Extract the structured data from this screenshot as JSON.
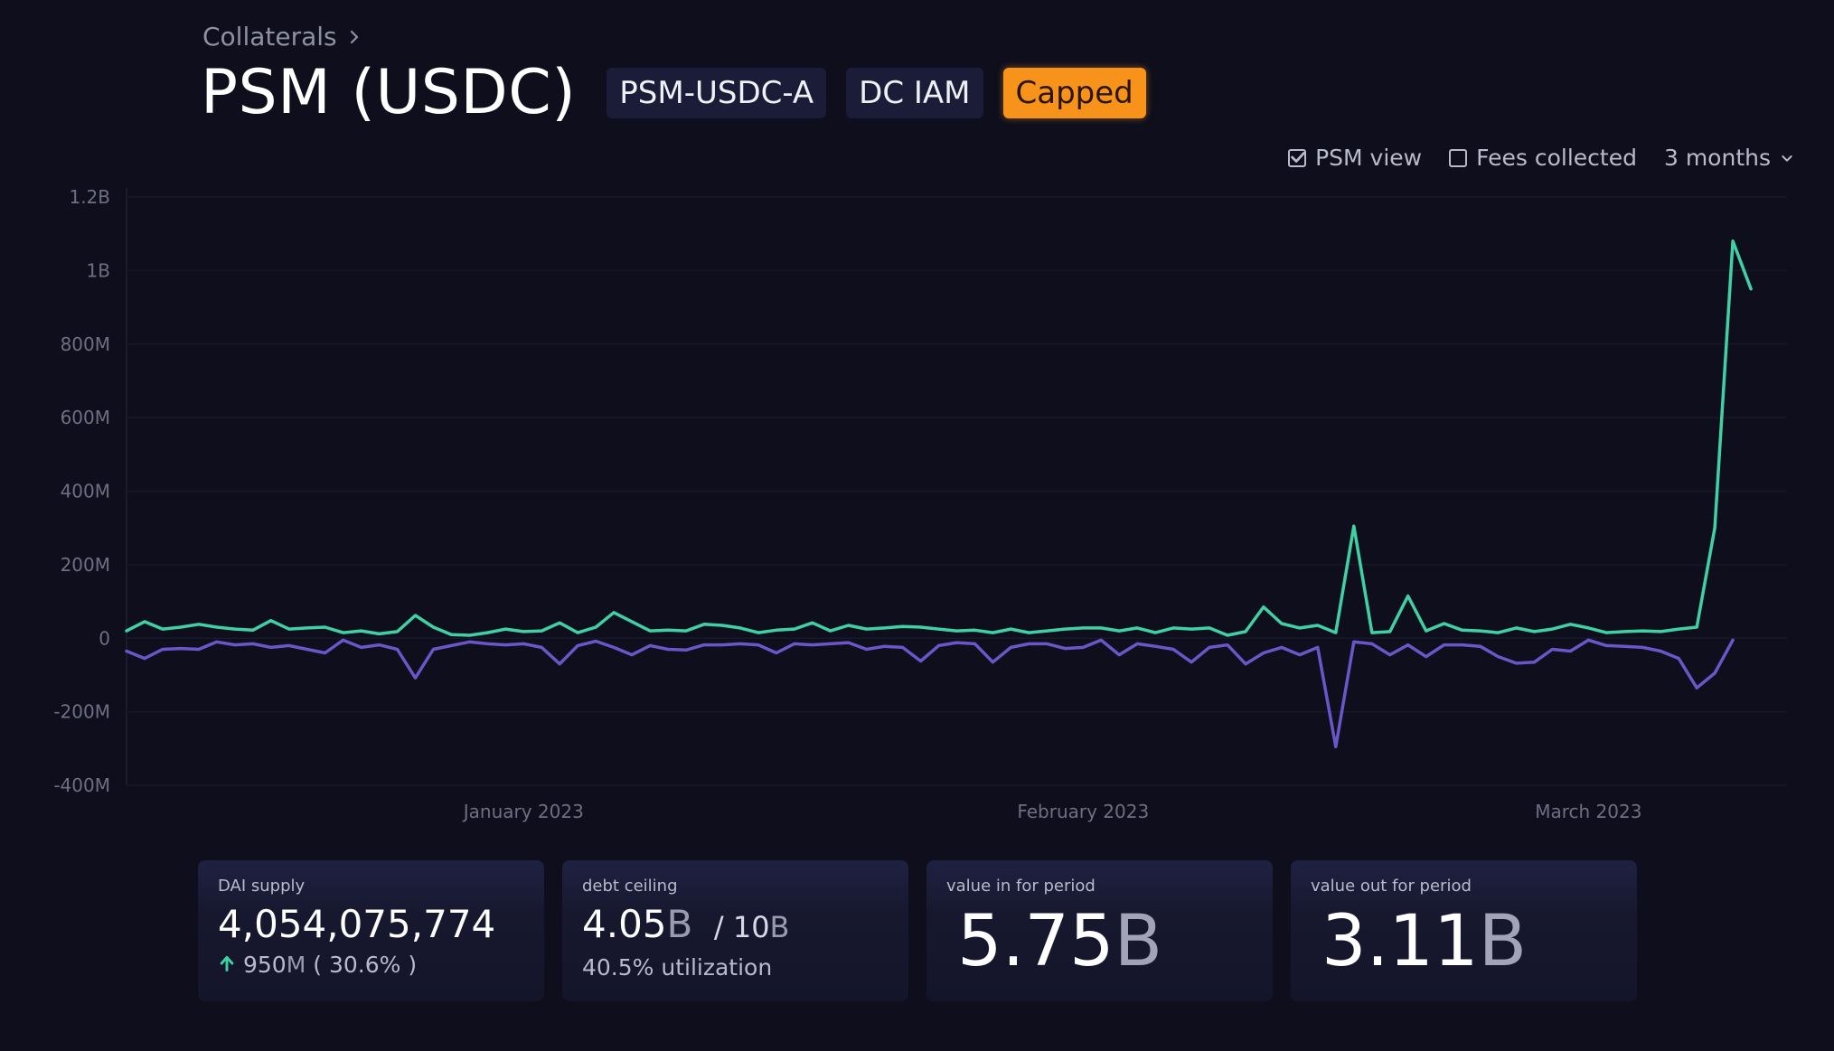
{
  "breadcrumb": {
    "label": "Collaterals"
  },
  "header": {
    "title": "PSM (USDC)",
    "tags": [
      "PSM-USDC-A",
      "DC IAM",
      "Capped"
    ]
  },
  "controls": {
    "psm_view": "PSM view",
    "fees_collected": "Fees collected",
    "period": "3 months"
  },
  "colors": {
    "inflow": "#3fd1a3",
    "outflow": "#6a56c8",
    "accent": "#f7931a"
  },
  "chart_data": {
    "type": "line",
    "ylim": [
      -400000000,
      1200000000
    ],
    "yticks": [
      {
        "value": 1200000000,
        "label": "1.2B"
      },
      {
        "value": 1000000000,
        "label": "1B"
      },
      {
        "value": 800000000,
        "label": "800M"
      },
      {
        "value": 600000000,
        "label": "600M"
      },
      {
        "value": 400000000,
        "label": "400M"
      },
      {
        "value": 200000000,
        "label": "200M"
      },
      {
        "value": 0,
        "label": "0"
      },
      {
        "value": -200000000,
        "label": "-200M"
      },
      {
        "value": -400000000,
        "label": "-400M"
      }
    ],
    "xlim": [
      "2022-12-10",
      "2023-03-12"
    ],
    "xticks": [
      {
        "date": "2023-01-01",
        "label": "January 2023"
      },
      {
        "date": "2023-02-01",
        "label": "February 2023"
      },
      {
        "date": "2023-03-01",
        "label": "March 2023"
      }
    ],
    "grid": true,
    "series": [
      {
        "color": "#3fd1a3",
        "points": [
          [
            "2022-12-10",
            20000000
          ],
          [
            "2022-12-11",
            45000000
          ],
          [
            "2022-12-12",
            25000000
          ],
          [
            "2022-12-13",
            30000000
          ],
          [
            "2022-12-14",
            38000000
          ],
          [
            "2022-12-15",
            30000000
          ],
          [
            "2022-12-16",
            25000000
          ],
          [
            "2022-12-17",
            22000000
          ],
          [
            "2022-12-18",
            48000000
          ],
          [
            "2022-12-19",
            25000000
          ],
          [
            "2022-12-20",
            28000000
          ],
          [
            "2022-12-21",
            30000000
          ],
          [
            "2022-12-22",
            15000000
          ],
          [
            "2022-12-23",
            20000000
          ],
          [
            "2022-12-24",
            12000000
          ],
          [
            "2022-12-25",
            18000000
          ],
          [
            "2022-12-26",
            62000000
          ],
          [
            "2022-12-27",
            30000000
          ],
          [
            "2022-12-28",
            10000000
          ],
          [
            "2022-12-29",
            8000000
          ],
          [
            "2022-12-30",
            15000000
          ],
          [
            "2022-12-31",
            25000000
          ],
          [
            "2023-01-01",
            18000000
          ],
          [
            "2023-01-02",
            20000000
          ],
          [
            "2023-01-03",
            42000000
          ],
          [
            "2023-01-04",
            15000000
          ],
          [
            "2023-01-05",
            30000000
          ],
          [
            "2023-01-06",
            70000000
          ],
          [
            "2023-01-07",
            45000000
          ],
          [
            "2023-01-08",
            20000000
          ],
          [
            "2023-01-09",
            22000000
          ],
          [
            "2023-01-10",
            20000000
          ],
          [
            "2023-01-11",
            38000000
          ],
          [
            "2023-01-12",
            35000000
          ],
          [
            "2023-01-13",
            28000000
          ],
          [
            "2023-01-14",
            15000000
          ],
          [
            "2023-01-15",
            22000000
          ],
          [
            "2023-01-16",
            25000000
          ],
          [
            "2023-01-17",
            42000000
          ],
          [
            "2023-01-18",
            20000000
          ],
          [
            "2023-01-19",
            35000000
          ],
          [
            "2023-01-20",
            25000000
          ],
          [
            "2023-01-21",
            28000000
          ],
          [
            "2023-01-22",
            32000000
          ],
          [
            "2023-01-23",
            30000000
          ],
          [
            "2023-01-24",
            25000000
          ],
          [
            "2023-01-25",
            20000000
          ],
          [
            "2023-01-26",
            22000000
          ],
          [
            "2023-01-27",
            15000000
          ],
          [
            "2023-01-28",
            25000000
          ],
          [
            "2023-01-29",
            15000000
          ],
          [
            "2023-01-30",
            20000000
          ],
          [
            "2023-01-31",
            25000000
          ],
          [
            "2023-02-01",
            28000000
          ],
          [
            "2023-02-02",
            28000000
          ],
          [
            "2023-02-03",
            20000000
          ],
          [
            "2023-02-04",
            28000000
          ],
          [
            "2023-02-05",
            15000000
          ],
          [
            "2023-02-06",
            28000000
          ],
          [
            "2023-02-07",
            25000000
          ],
          [
            "2023-02-08",
            28000000
          ],
          [
            "2023-02-09",
            8000000
          ],
          [
            "2023-02-10",
            18000000
          ],
          [
            "2023-02-11",
            85000000
          ],
          [
            "2023-02-12",
            40000000
          ],
          [
            "2023-02-13",
            28000000
          ],
          [
            "2023-02-14",
            35000000
          ],
          [
            "2023-02-15",
            15000000
          ],
          [
            "2023-02-16",
            305000000
          ],
          [
            "2023-02-17",
            15000000
          ],
          [
            "2023-02-18",
            18000000
          ],
          [
            "2023-02-19",
            115000000
          ],
          [
            "2023-02-20",
            20000000
          ],
          [
            "2023-02-21",
            40000000
          ],
          [
            "2023-02-22",
            22000000
          ],
          [
            "2023-02-23",
            20000000
          ],
          [
            "2023-02-24",
            15000000
          ],
          [
            "2023-02-25",
            28000000
          ],
          [
            "2023-02-26",
            18000000
          ],
          [
            "2023-02-27",
            25000000
          ],
          [
            "2023-02-28",
            38000000
          ],
          [
            "2023-03-01",
            28000000
          ],
          [
            "2023-03-02",
            15000000
          ],
          [
            "2023-03-03",
            18000000
          ],
          [
            "2023-03-04",
            20000000
          ],
          [
            "2023-03-05",
            18000000
          ],
          [
            "2023-03-06",
            25000000
          ],
          [
            "2023-03-07",
            30000000
          ],
          [
            "2023-03-08",
            300000000
          ],
          [
            "2023-03-09",
            1080000000
          ],
          [
            "2023-03-10",
            950000000
          ]
        ]
      },
      {
        "color": "#6a56c8",
        "points": [
          [
            "2022-12-10",
            -35000000
          ],
          [
            "2022-12-11",
            -55000000
          ],
          [
            "2022-12-12",
            -30000000
          ],
          [
            "2022-12-13",
            -28000000
          ],
          [
            "2022-12-14",
            -30000000
          ],
          [
            "2022-12-15",
            -10000000
          ],
          [
            "2022-12-16",
            -18000000
          ],
          [
            "2022-12-17",
            -15000000
          ],
          [
            "2022-12-18",
            -25000000
          ],
          [
            "2022-12-19",
            -20000000
          ],
          [
            "2022-12-20",
            -30000000
          ],
          [
            "2022-12-21",
            -40000000
          ],
          [
            "2022-12-22",
            -5000000
          ],
          [
            "2022-12-23",
            -25000000
          ],
          [
            "2022-12-24",
            -18000000
          ],
          [
            "2022-12-25",
            -30000000
          ],
          [
            "2022-12-26",
            -108000000
          ],
          [
            "2022-12-27",
            -30000000
          ],
          [
            "2022-12-28",
            -20000000
          ],
          [
            "2022-12-29",
            -10000000
          ],
          [
            "2022-12-30",
            -15000000
          ],
          [
            "2022-12-31",
            -18000000
          ],
          [
            "2023-01-01",
            -15000000
          ],
          [
            "2023-01-02",
            -25000000
          ],
          [
            "2023-01-03",
            -70000000
          ],
          [
            "2023-01-04",
            -20000000
          ],
          [
            "2023-01-05",
            -8000000
          ],
          [
            "2023-01-06",
            -25000000
          ],
          [
            "2023-01-07",
            -45000000
          ],
          [
            "2023-01-08",
            -20000000
          ],
          [
            "2023-01-09",
            -30000000
          ],
          [
            "2023-01-10",
            -32000000
          ],
          [
            "2023-01-11",
            -18000000
          ],
          [
            "2023-01-12",
            -18000000
          ],
          [
            "2023-01-13",
            -15000000
          ],
          [
            "2023-01-14",
            -18000000
          ],
          [
            "2023-01-15",
            -40000000
          ],
          [
            "2023-01-16",
            -15000000
          ],
          [
            "2023-01-17",
            -18000000
          ],
          [
            "2023-01-18",
            -15000000
          ],
          [
            "2023-01-19",
            -12000000
          ],
          [
            "2023-01-20",
            -30000000
          ],
          [
            "2023-01-21",
            -22000000
          ],
          [
            "2023-01-22",
            -25000000
          ],
          [
            "2023-01-23",
            -62000000
          ],
          [
            "2023-01-24",
            -20000000
          ],
          [
            "2023-01-25",
            -12000000
          ],
          [
            "2023-01-26",
            -15000000
          ],
          [
            "2023-01-27",
            -65000000
          ],
          [
            "2023-01-28",
            -25000000
          ],
          [
            "2023-01-29",
            -15000000
          ],
          [
            "2023-01-30",
            -15000000
          ],
          [
            "2023-01-31",
            -28000000
          ],
          [
            "2023-02-01",
            -25000000
          ],
          [
            "2023-02-02",
            -5000000
          ],
          [
            "2023-02-03",
            -45000000
          ],
          [
            "2023-02-04",
            -15000000
          ],
          [
            "2023-02-05",
            -22000000
          ],
          [
            "2023-02-06",
            -30000000
          ],
          [
            "2023-02-07",
            -65000000
          ],
          [
            "2023-02-08",
            -25000000
          ],
          [
            "2023-02-09",
            -18000000
          ],
          [
            "2023-02-10",
            -70000000
          ],
          [
            "2023-02-11",
            -40000000
          ],
          [
            "2023-02-12",
            -25000000
          ],
          [
            "2023-02-13",
            -45000000
          ],
          [
            "2023-02-14",
            -25000000
          ],
          [
            "2023-02-15",
            -295000000
          ],
          [
            "2023-02-16",
            -10000000
          ],
          [
            "2023-02-17",
            -15000000
          ],
          [
            "2023-02-18",
            -45000000
          ],
          [
            "2023-02-19",
            -18000000
          ],
          [
            "2023-02-20",
            -50000000
          ],
          [
            "2023-02-21",
            -18000000
          ],
          [
            "2023-02-22",
            -18000000
          ],
          [
            "2023-02-23",
            -22000000
          ],
          [
            "2023-02-24",
            -50000000
          ],
          [
            "2023-02-25",
            -68000000
          ],
          [
            "2023-02-26",
            -65000000
          ],
          [
            "2023-02-27",
            -30000000
          ],
          [
            "2023-02-28",
            -35000000
          ],
          [
            "2023-03-01",
            -5000000
          ],
          [
            "2023-03-02",
            -20000000
          ],
          [
            "2023-03-03",
            -22000000
          ],
          [
            "2023-03-04",
            -25000000
          ],
          [
            "2023-03-05",
            -35000000
          ],
          [
            "2023-03-06",
            -55000000
          ],
          [
            "2023-03-07",
            -135000000
          ],
          [
            "2023-03-08",
            -95000000
          ],
          [
            "2023-03-09",
            -5000000
          ]
        ]
      }
    ]
  },
  "cards": {
    "dai_supply": {
      "label": "DAI supply",
      "value": "4,054,075,774",
      "change_value": "950",
      "change_unit": "M",
      "change_pct": "( 30.6% )"
    },
    "debt_ceiling": {
      "label": "debt ceiling",
      "value_num": "4.05",
      "value_unit": "B",
      "separator": "/",
      "total_num": "10",
      "total_unit": "B",
      "utilization": "40.5% utilization"
    },
    "value_in": {
      "label": "value in for period",
      "value_num": "5.75",
      "value_unit": "B"
    },
    "value_out": {
      "label": "value out for period",
      "value_num": "3.11",
      "value_unit": "B"
    }
  }
}
